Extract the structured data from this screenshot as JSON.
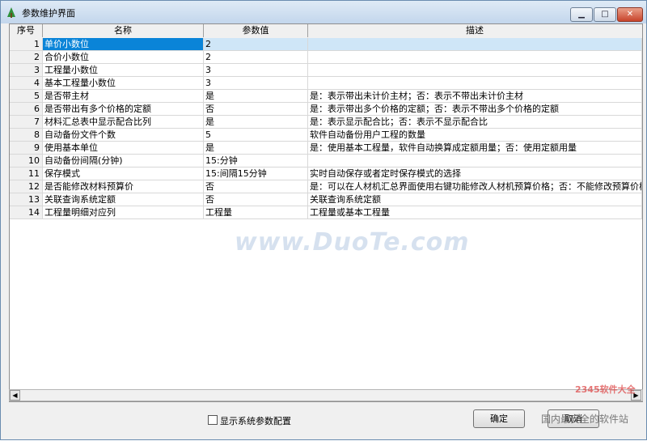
{
  "window": {
    "title": "参数维护界面",
    "min_glyph": "▁",
    "max_glyph": "□",
    "close_glyph": "✕"
  },
  "grid": {
    "columns": [
      "序号",
      "名称",
      "参数值",
      "描述"
    ],
    "rows": [
      {
        "no": "1",
        "name": "单价小数位",
        "value": "2",
        "desc": ""
      },
      {
        "no": "2",
        "name": "合价小数位",
        "value": "2",
        "desc": ""
      },
      {
        "no": "3",
        "name": "工程量小数位",
        "value": "3",
        "desc": ""
      },
      {
        "no": "4",
        "name": "基本工程量小数位",
        "value": "3",
        "desc": ""
      },
      {
        "no": "5",
        "name": "是否带主材",
        "value": "是",
        "desc": "是：表示带出未计价主材；否：表示不带出未计价主材"
      },
      {
        "no": "6",
        "name": "是否带出有多个价格的定额",
        "value": "否",
        "desc": "是：表示带出多个价格的定额；否：表示不带出多个价格的定额"
      },
      {
        "no": "7",
        "name": "材料汇总表中显示配合比列",
        "value": "是",
        "desc": "是：表示显示配合比；否：表示不显示配合比"
      },
      {
        "no": "8",
        "name": "自动备份文件个数",
        "value": "5",
        "desc": "软件自动备份用户工程的数量"
      },
      {
        "no": "9",
        "name": "使用基本单位",
        "value": "是",
        "desc": "是：使用基本工程量，软件自动换算成定额用量；否：使用定额用量"
      },
      {
        "no": "10",
        "name": "自动备份间隔(分钟)",
        "value": "15:分钟",
        "desc": ""
      },
      {
        "no": "11",
        "name": "保存模式",
        "value": "15:间隔15分钟",
        "desc": "实时自动保存或者定时保存模式的选择"
      },
      {
        "no": "12",
        "name": "是否能修改材料预算价",
        "value": "否",
        "desc": "是：可以在人材机汇总界面使用右键功能修改人材机预算价格；否：不能修改预算价格"
      },
      {
        "no": "13",
        "name": "关联查询系统定额",
        "value": "否",
        "desc": "关联查询系统定额"
      },
      {
        "no": "14",
        "name": "工程量明细对应列",
        "value": "工程量",
        "desc": "工程量或基本工程量"
      }
    ]
  },
  "scrollbar": {
    "left_glyph": "◀",
    "right_glyph": "▶"
  },
  "footer": {
    "show_system_config_label": "显示系统参数配置",
    "ok_label": "确定",
    "cancel_label": "取消"
  },
  "watermark": {
    "center": "www.DuoTe.com",
    "corner_logo": "2345软件大全",
    "corner_text": "国内最安全的软件站"
  }
}
